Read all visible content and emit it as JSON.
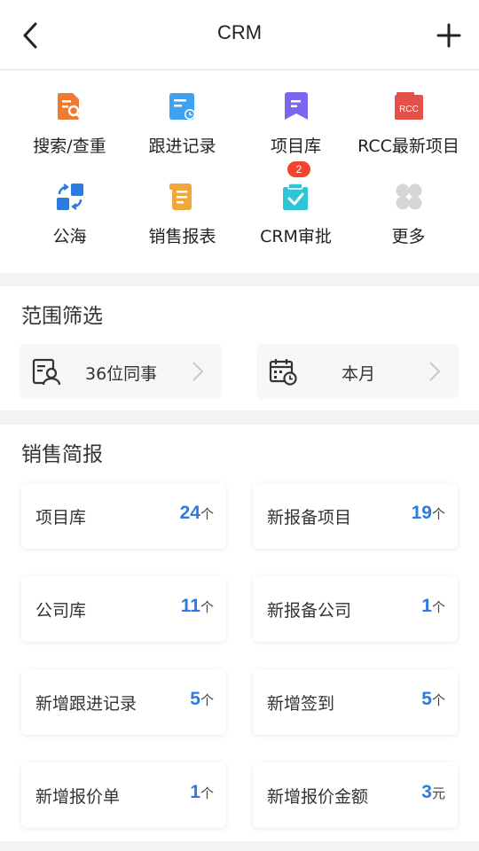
{
  "navbar": {
    "title": "CRM"
  },
  "grid": {
    "items": [
      {
        "label": "搜索/查重",
        "icon": "search-doc-icon"
      },
      {
        "label": "跟进记录",
        "icon": "follow-record-icon"
      },
      {
        "label": "项目库",
        "icon": "bookmark-icon"
      },
      {
        "label": "RCC最新项目",
        "icon": "rcc-icon",
        "icon_text": "RCC"
      },
      {
        "label": "公海",
        "icon": "public-sea-icon"
      },
      {
        "label": "销售报表",
        "icon": "sales-report-icon"
      },
      {
        "label": "CRM审批",
        "icon": "approval-icon",
        "badge": "2"
      },
      {
        "label": "更多",
        "icon": "more-icon"
      }
    ]
  },
  "filter": {
    "title": "范围筛选",
    "colleagues": "36位同事",
    "period": "本月"
  },
  "sales": {
    "title": "销售简报",
    "cards": [
      {
        "label": "项目库",
        "value": "24",
        "unit": "个"
      },
      {
        "label": "新报备项目",
        "value": "19",
        "unit": "个"
      },
      {
        "label": "公司库",
        "value": "11",
        "unit": "个"
      },
      {
        "label": "新报备公司",
        "value": "1",
        "unit": "个"
      },
      {
        "label": "新增跟进记录",
        "value": "5",
        "unit": "个"
      },
      {
        "label": "新增签到",
        "value": "5",
        "unit": "个"
      },
      {
        "label": "新增报价单",
        "value": "1",
        "unit": "个"
      },
      {
        "label": "新增报价金额",
        "value": "3",
        "unit": "元"
      }
    ]
  },
  "colors": {
    "accent_blue": "#2b7be0",
    "badge_red": "#f5432d",
    "icon_orange": "#f07a30",
    "icon_purple": "#7b66f0",
    "icon_red": "#e5504a"
  }
}
